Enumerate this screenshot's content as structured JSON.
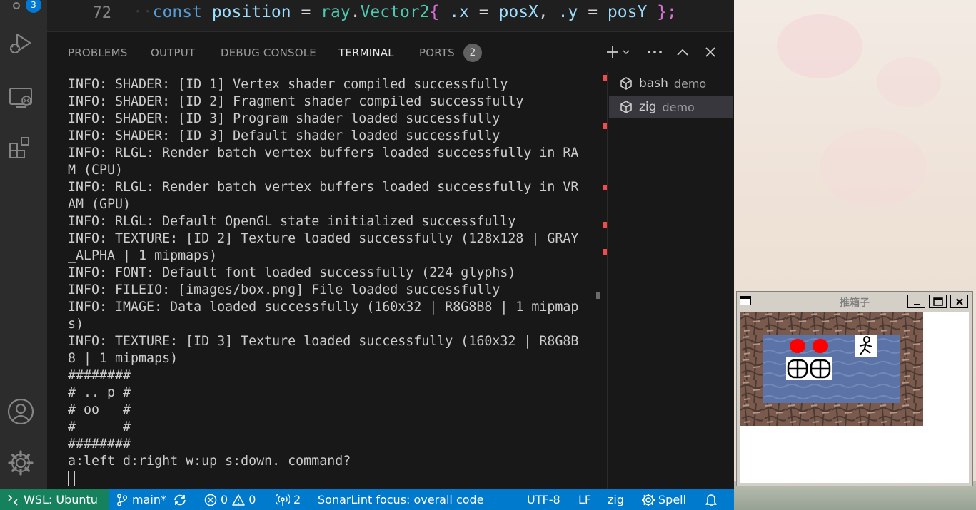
{
  "activity_bar": {
    "source_control_badge": "3"
  },
  "editor": {
    "line_number": "72",
    "code": {
      "keyword": "const",
      "name": "position",
      "eq": "=",
      "module": "ray",
      "dot": ".",
      "type": "Vector2",
      "open": "{",
      "field_x": ".x",
      "eq2": "=",
      "val_x": "posX",
      "comma": ",",
      "field_y": ".y",
      "eq3": "=",
      "val_y": "posY",
      "close": "};"
    }
  },
  "panel": {
    "tabs": [
      {
        "label": "PROBLEMS"
      },
      {
        "label": "OUTPUT"
      },
      {
        "label": "DEBUG CONSOLE"
      },
      {
        "label": "TERMINAL"
      },
      {
        "label": "PORTS"
      }
    ],
    "active_tab": "TERMINAL",
    "ports_badge": "2",
    "terminal_lines": [
      "INFO: SHADER: [ID 1] Vertex shader compiled successfully",
      "INFO: SHADER: [ID 2] Fragment shader compiled successfully",
      "INFO: SHADER: [ID 3] Program shader loaded successfully",
      "INFO: SHADER: [ID 3] Default shader loaded successfully",
      "INFO: RLGL: Render batch vertex buffers loaded successfully in RA",
      "M (CPU)",
      "INFO: RLGL: Render batch vertex buffers loaded successfully in VR",
      "AM (GPU)",
      "INFO: RLGL: Default OpenGL state initialized successfully",
      "INFO: TEXTURE: [ID 2] Texture loaded successfully (128x128 | GRAY",
      "_ALPHA | 1 mipmaps)",
      "INFO: FONT: Default font loaded successfully (224 glyphs)",
      "INFO: FILEIO: [images/box.png] File loaded successfully",
      "INFO: IMAGE: Data loaded successfully (160x32 | R8G8B8 | 1 mipmap",
      "s)",
      "INFO: TEXTURE: [ID 3] Texture loaded successfully (160x32 | R8G8B",
      "8 | 1 mipmaps)",
      "########",
      "# .. p #",
      "# oo   #",
      "#      #",
      "########",
      "a:left d:right w:up s:down. command?"
    ],
    "terminals": [
      {
        "name": "bash",
        "sub": "demo",
        "selected": false
      },
      {
        "name": "zig",
        "sub": "demo",
        "selected": true
      }
    ]
  },
  "status_bar": {
    "remote": "WSL: Ubuntu",
    "branch": "main*",
    "errors": "0",
    "warnings": "0",
    "ports": "2",
    "sonarlint": "SonarLint focus: overall code",
    "encoding": "UTF-8",
    "eol": "LF",
    "language": "zig",
    "spell": "Spell"
  },
  "game_window": {
    "title": "推箱子",
    "board": [
      "########",
      "# .. p #",
      "# oo   #",
      "#      #",
      "########"
    ]
  },
  "colors": {
    "status_bar": "#007acc",
    "remote_indicator": "#16825d",
    "terminal_bg": "#181818",
    "goal": "#ff0000",
    "floor": "#5b73a6"
  }
}
